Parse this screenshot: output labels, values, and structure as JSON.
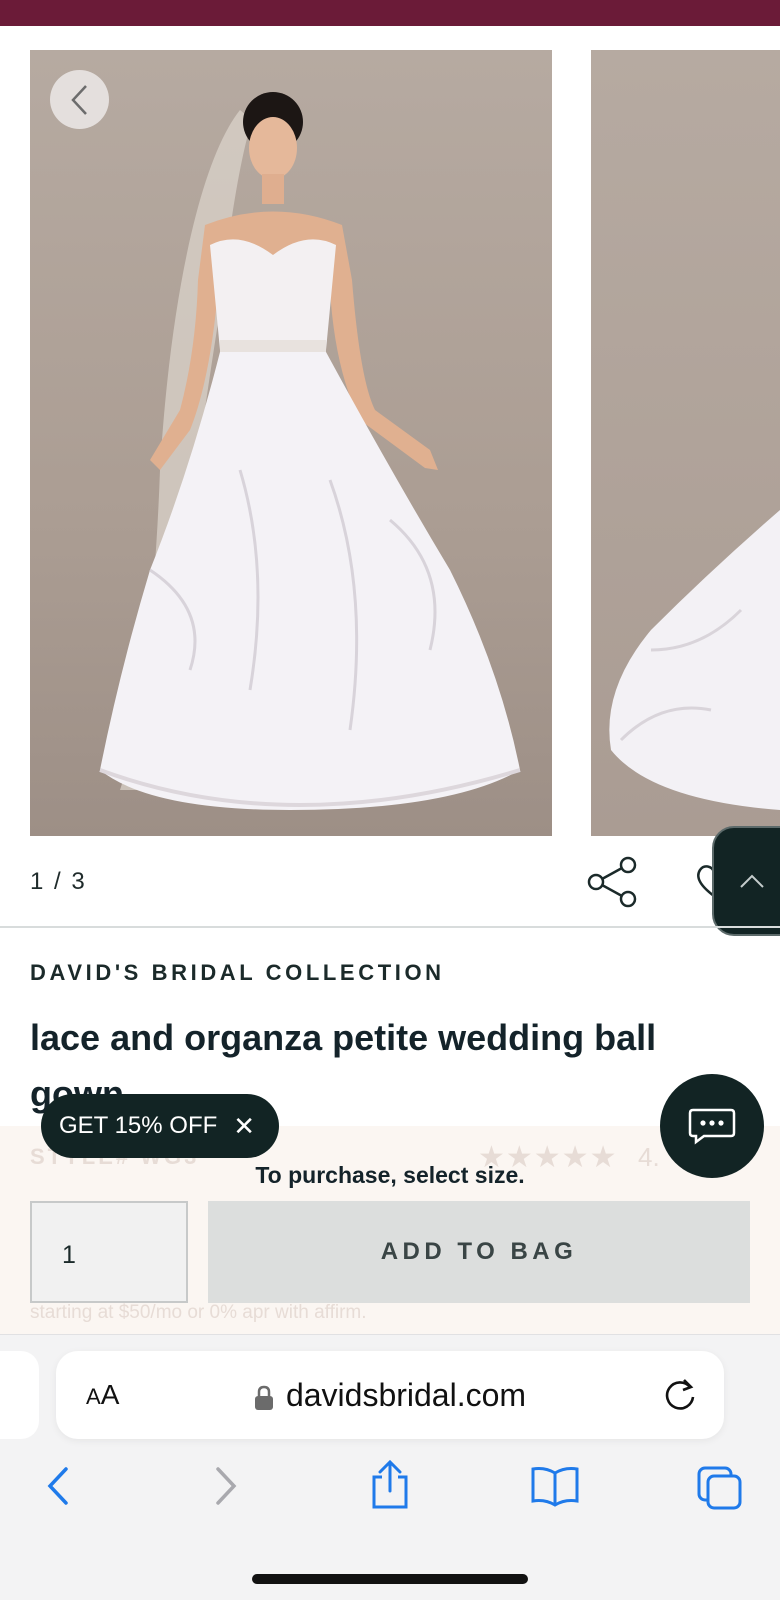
{
  "gallery": {
    "counter": "1 / 3"
  },
  "product": {
    "brand": "DAVID'S BRIDAL COLLECTION",
    "title": "lace and organza petite wedding ball gown",
    "style_ghost": "STYLE# WG3",
    "stars_ghost": "★★★★★",
    "rating_ghost": "4.",
    "finance_ghost": "starting at $50/mo or 0% apr with affirm."
  },
  "purchase": {
    "prompt": "To purchase, select size.",
    "quantity": "1",
    "add_to_bag_label": "ADD TO BAG"
  },
  "promo": {
    "label": "GET 15% OFF",
    "close": "✕"
  },
  "browser": {
    "aa_label_small": "A",
    "aa_label_large": "A",
    "domain": "davidsbridal.com"
  },
  "colors": {
    "brand_bar": "#6b1b38",
    "dark_accent": "#122424",
    "ios_blue": "#1f7aea"
  },
  "icons": [
    "chevron-left-icon",
    "share-icon",
    "heart-icon",
    "chevron-up-icon",
    "chat-icon",
    "lock-icon",
    "reload-icon",
    "back-icon",
    "forward-icon",
    "share-sheet-icon",
    "bookmarks-icon",
    "tabs-icon"
  ]
}
